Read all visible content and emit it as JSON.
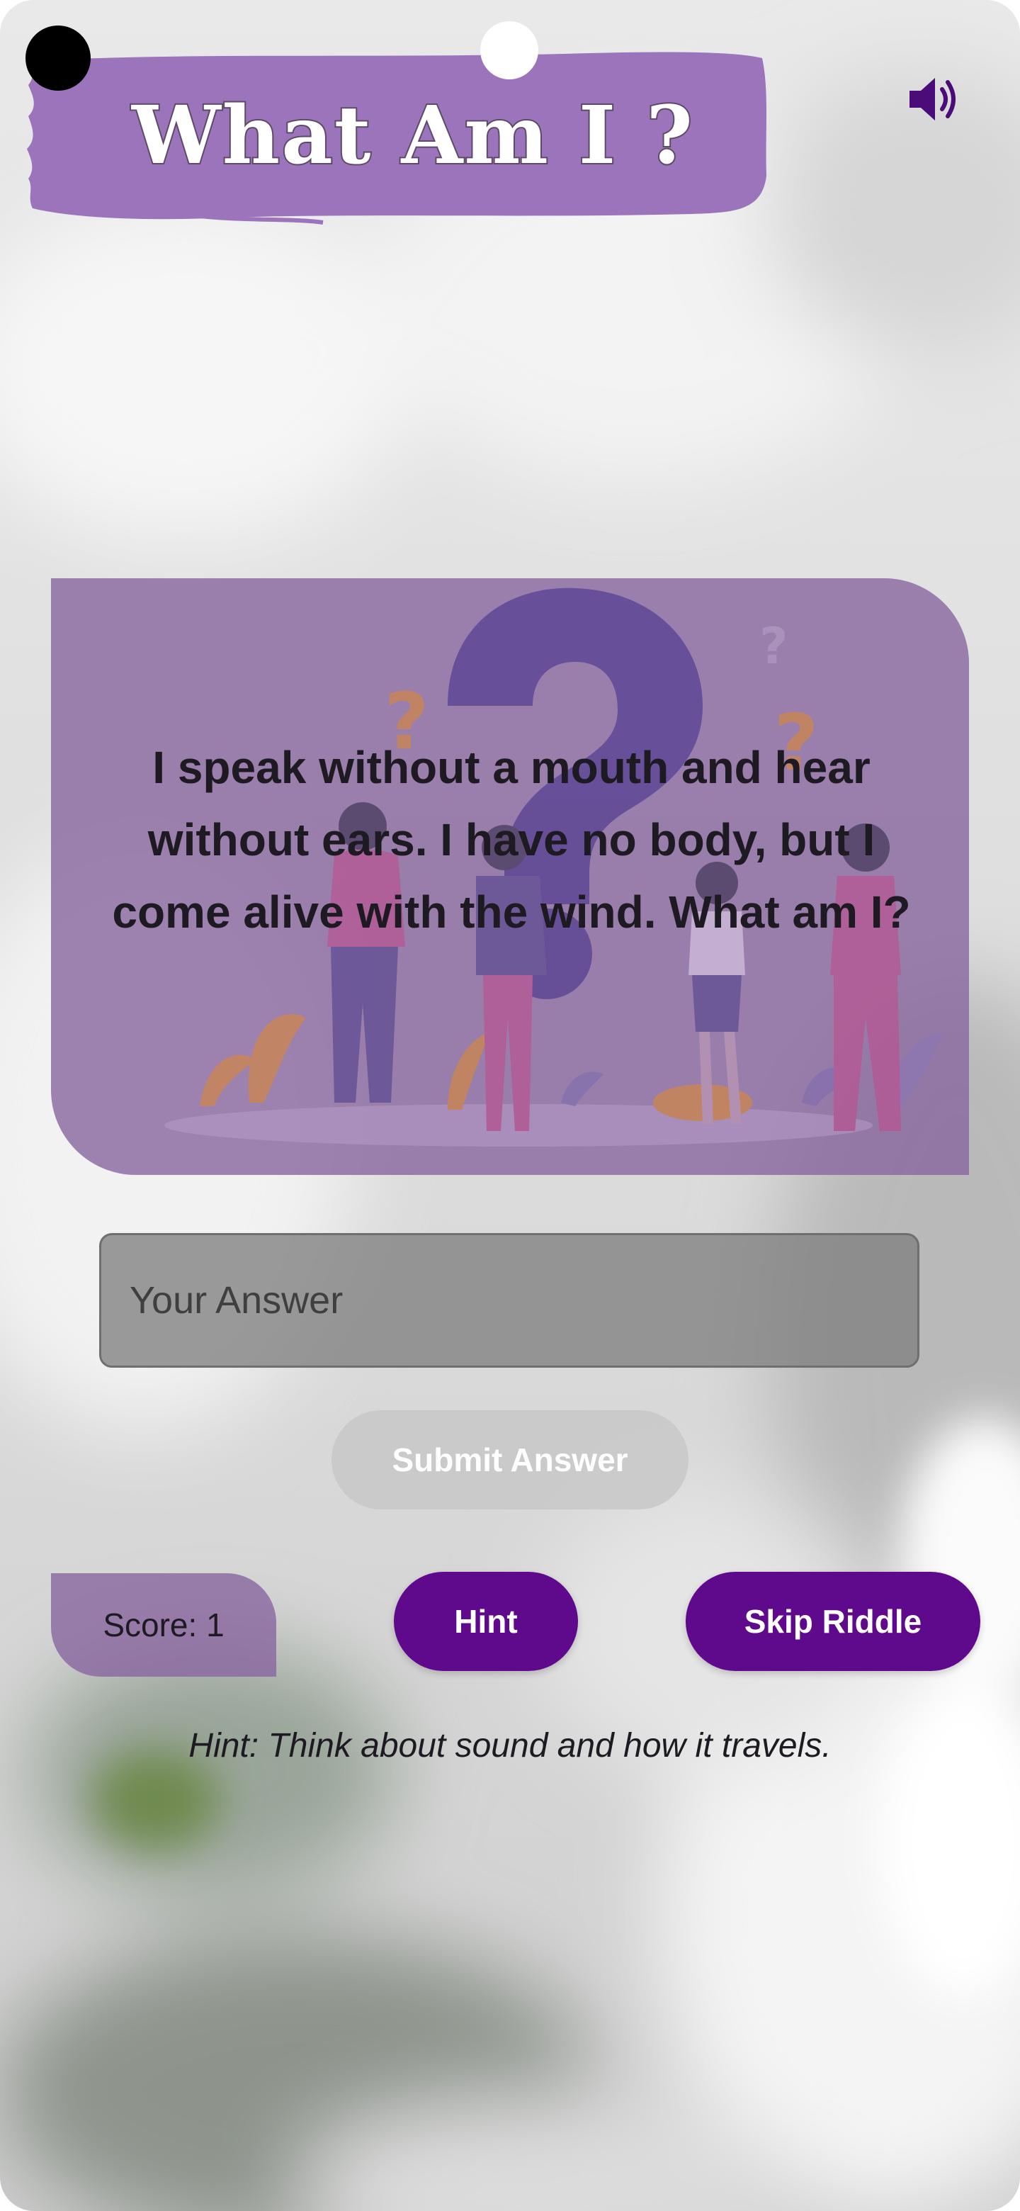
{
  "app": {
    "title": "What Am I ?"
  },
  "header": {
    "sound_icon": "speaker-volume-icon"
  },
  "riddle": {
    "text": "I speak without a mouth and hear without ears. I have no body, but I come alive with the wind. What am I?"
  },
  "answer": {
    "placeholder": "Your Answer",
    "value": ""
  },
  "actions": {
    "submit_label": "Submit Answer",
    "hint_label": "Hint",
    "skip_label": "Skip Riddle"
  },
  "score": {
    "label": "Score: 1"
  },
  "hint": {
    "text": "Hint: Think about sound and how it travels."
  },
  "colors": {
    "primary": "#5f0a8c",
    "card": "#8a68a0",
    "banner": "#9b74bb",
    "icon": "#4b0b78"
  }
}
